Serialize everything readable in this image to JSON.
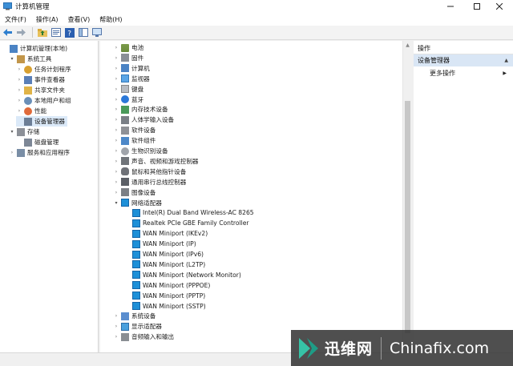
{
  "window": {
    "title": "计算机管理"
  },
  "menu": [
    "文件(F)",
    "操作(A)",
    "查看(V)",
    "帮助(H)"
  ],
  "toolbar": [
    "back-icon",
    "forward-icon",
    "up-folder-icon",
    "properties-icon",
    "help-icon",
    "show-hide-icon",
    "console-icon"
  ],
  "left_tree": [
    {
      "label": "计算机管理(本地)",
      "icon": "computer-icon",
      "level": 0,
      "expander": ""
    },
    {
      "label": "系统工具",
      "icon": "tools-icon",
      "level": 1,
      "expander": "▾"
    },
    {
      "label": "任务计划程序",
      "icon": "clock-icon",
      "level": 2,
      "expander": "›"
    },
    {
      "label": "事件查看器",
      "icon": "event-viewer-icon",
      "level": 2,
      "expander": "›"
    },
    {
      "label": "共享文件夹",
      "icon": "shared-folder-icon",
      "level": 2,
      "expander": "›"
    },
    {
      "label": "本地用户和组",
      "icon": "users-icon",
      "level": 2,
      "expander": "›"
    },
    {
      "label": "性能",
      "icon": "performance-icon",
      "level": 2,
      "expander": "›"
    },
    {
      "label": "设备管理器",
      "icon": "device-manager-icon",
      "level": 2,
      "expander": "",
      "selected": true
    },
    {
      "label": "存储",
      "icon": "storage-icon",
      "level": 1,
      "expander": "▾"
    },
    {
      "label": "磁盘管理",
      "icon": "disk-management-icon",
      "level": 2,
      "expander": ""
    },
    {
      "label": "服务和应用程序",
      "icon": "services-icon",
      "level": 1,
      "expander": "›"
    }
  ],
  "device_tree": [
    {
      "label": "电池",
      "icon": "battery-icon",
      "expander": "›",
      "level": 0
    },
    {
      "label": "固件",
      "icon": "firmware-icon",
      "expander": "›",
      "level": 0
    },
    {
      "label": "计算机",
      "icon": "computer-icon",
      "expander": "›",
      "level": 0
    },
    {
      "label": "监视器",
      "icon": "monitor-icon",
      "expander": "›",
      "level": 0
    },
    {
      "label": "键盘",
      "icon": "keyboard-icon",
      "expander": "›",
      "level": 0
    },
    {
      "label": "蓝牙",
      "icon": "bluetooth-icon",
      "expander": "›",
      "level": 0
    },
    {
      "label": "内存技术设备",
      "icon": "memory-device-icon",
      "expander": "›",
      "level": 0
    },
    {
      "label": "人体学输入设备",
      "icon": "hid-icon",
      "expander": "›",
      "level": 0
    },
    {
      "label": "软件设备",
      "icon": "software-device-icon",
      "expander": "›",
      "level": 0
    },
    {
      "label": "软件组件",
      "icon": "software-component-icon",
      "expander": "›",
      "level": 0
    },
    {
      "label": "生物识别设备",
      "icon": "biometric-icon",
      "expander": "›",
      "level": 0
    },
    {
      "label": "声音、视频和游戏控制器",
      "icon": "sound-icon",
      "expander": "›",
      "level": 0
    },
    {
      "label": "鼠标和其他指针设备",
      "icon": "mouse-icon",
      "expander": "›",
      "level": 0
    },
    {
      "label": "通用串行总线控制器",
      "icon": "usb-icon",
      "expander": "›",
      "level": 0
    },
    {
      "label": "图像设备",
      "icon": "camera-icon",
      "expander": "›",
      "level": 0
    },
    {
      "label": "网络适配器",
      "icon": "network-adapter-icon",
      "expander": "▾",
      "level": 0
    },
    {
      "label": "Intel(R) Dual Band Wireless-AC 8265",
      "icon": "network-adapter-icon",
      "expander": "",
      "level": 1
    },
    {
      "label": "Realtek PCIe GBE Family Controller",
      "icon": "network-adapter-icon",
      "expander": "",
      "level": 1
    },
    {
      "label": "WAN Miniport (IKEv2)",
      "icon": "network-adapter-icon",
      "expander": "",
      "level": 1
    },
    {
      "label": "WAN Miniport (IP)",
      "icon": "network-adapter-icon",
      "expander": "",
      "level": 1
    },
    {
      "label": "WAN Miniport (IPv6)",
      "icon": "network-adapter-icon",
      "expander": "",
      "level": 1
    },
    {
      "label": "WAN Miniport (L2TP)",
      "icon": "network-adapter-icon",
      "expander": "",
      "level": 1
    },
    {
      "label": "WAN Miniport (Network Monitor)",
      "icon": "network-adapter-icon",
      "expander": "",
      "level": 1
    },
    {
      "label": "WAN Miniport (PPPOE)",
      "icon": "network-adapter-icon",
      "expander": "",
      "level": 1
    },
    {
      "label": "WAN Miniport (PPTP)",
      "icon": "network-adapter-icon",
      "expander": "",
      "level": 1
    },
    {
      "label": "WAN Miniport (SSTP)",
      "icon": "network-adapter-icon",
      "expander": "",
      "level": 1
    },
    {
      "label": "系统设备",
      "icon": "system-device-icon",
      "expander": "›",
      "level": 0
    },
    {
      "label": "显示适配器",
      "icon": "display-adapter-icon",
      "expander": "›",
      "level": 0
    },
    {
      "label": "音频输入和输出",
      "icon": "audio-io-icon",
      "expander": "›",
      "level": 0
    }
  ],
  "actions": {
    "header": "操作",
    "section": "设备管理器",
    "more": "更多操作"
  },
  "watermark": {
    "cn": "迅维网",
    "en": "Chinafix.com"
  },
  "colors": {
    "selection": "#dbe9f8",
    "accent": "#1e90d8",
    "watermark_bg": "#373737"
  }
}
